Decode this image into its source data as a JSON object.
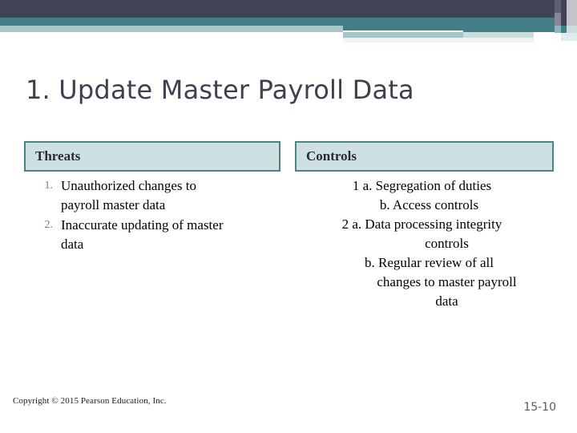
{
  "slide": {
    "title": "1. Update Master Payroll Data",
    "page_number": "15-10",
    "copyright": "Copyright © 2015 Pearson Education, Inc."
  },
  "colors": {
    "header_navy": "#434357",
    "header_teal": "#427e85",
    "header_light": "#a8c5c9",
    "title_text": "#3f3f52",
    "table_header_fill": "#cde0e2",
    "table_header_border": "#4c8288",
    "list_number": "#8f6f8f"
  },
  "table": {
    "columns": [
      {
        "header": "Threats",
        "items": [
          {
            "number": "1.",
            "text": "Unauthorized changes to payroll master data"
          },
          {
            "number": "2.",
            "text": "Inaccurate updating of master data"
          }
        ]
      },
      {
        "header": "Controls",
        "lines": [
          {
            "text": "1 a. Segregation of duties",
            "indent": 0
          },
          {
            "text": "b. Access controls",
            "indent": 1
          },
          {
            "text": "2 a. Data processing integrity",
            "indent": 0
          },
          {
            "text": "controls",
            "indent": 2
          },
          {
            "text": "b. Regular review of all",
            "indent": 1
          },
          {
            "text": "changes to master payroll",
            "indent": 2
          },
          {
            "text": "data",
            "indent": 2
          }
        ]
      }
    ]
  }
}
